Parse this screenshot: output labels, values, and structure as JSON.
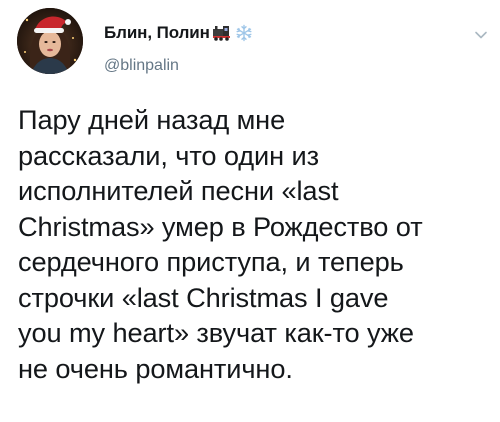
{
  "tweet": {
    "display_name": "Блин, Полин",
    "handle": "@blinpalin",
    "text": "Пару дней назад мне\nрассказали, что один из\nисполнителей песни «last\nChristmas» умер в Рождество от\nсердечного приступа, и теперь\nстрочки «last Christmas I gave\nyou my heart» звучат как-то уже\nне очень романтично.",
    "name_emojis": [
      "locomotive-icon",
      "snowflake-icon"
    ]
  },
  "colors": {
    "text": "#14171a",
    "secondary": "#657786",
    "snowflake": "#9fc6e8",
    "caret": "#aab8c2"
  }
}
